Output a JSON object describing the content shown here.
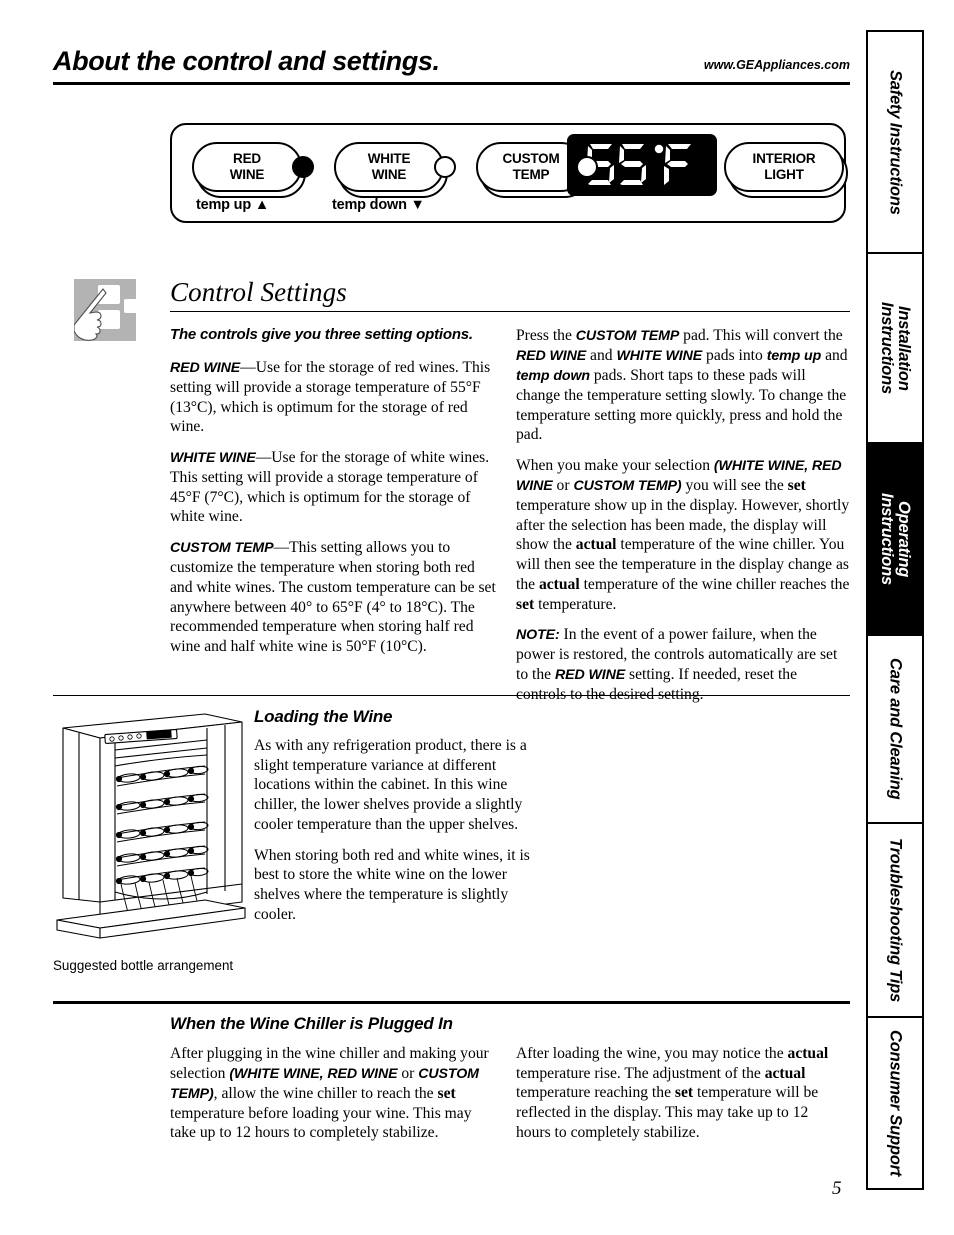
{
  "header": {
    "title": "About the control and settings.",
    "url": "www.GEAppliances.com"
  },
  "control_panel": {
    "pads": [
      {
        "label": "RED\nWINE",
        "sub": "temp up ▲",
        "indicator": "filled"
      },
      {
        "label": "WHITE\nWINE",
        "sub": "temp down ▼",
        "indicator": "hollow"
      },
      {
        "label": "CUSTOM\nTEMP",
        "sub": "",
        "indicator": "hollow"
      },
      {
        "label": "INTERIOR\nLIGHT",
        "sub": "",
        "indicator": "none"
      }
    ],
    "display_value": "55°F"
  },
  "control_settings": {
    "heading": "Control Settings",
    "intro": "The controls give you three setting options.",
    "red_wine_label": "RED WINE",
    "red_wine_text": "—Use for the storage of red wines. This setting will provide a storage temperature of 55°F (13°C), which is optimum for the storage of red wine.",
    "white_wine_label": "WHITE WINE",
    "white_wine_text": "—Use for the storage of white wines. This setting will provide a storage temperature of 45°F (7°C), which is optimum for the storage of white wine.",
    "custom_temp_label": "CUSTOM TEMP",
    "custom_temp_text": "—This setting allows you to customize the temperature when storing both red and white wines. The custom temperature can be set anywhere between 40° to 65°F (4° to 18°C). The recommended temperature when storing half red wine and half white wine is 50°F (10°C).",
    "p_press_1": "Press the ",
    "p_press_custom": "CUSTOM TEMP",
    "p_press_2": " pad. This will convert the ",
    "p_press_red": "RED WINE",
    "p_press_3": " and ",
    "p_press_white": "WHITE WINE",
    "p_press_4": " pads into ",
    "p_press_tempup": "temp up",
    "p_press_5": " and ",
    "p_press_tempdown": "temp down",
    "p_press_6": " pads. Short taps to these pads will change the temperature setting slowly. To change the temperature setting more quickly, press and hold the pad.",
    "p_sel_1": "When you make your selection ",
    "p_sel_paren": "(WHITE WINE, RED WINE",
    "p_sel_or": " or ",
    "p_sel_paren2": "CUSTOM TEMP)",
    "p_sel_2": " you will see the ",
    "p_sel_set": "set",
    "p_sel_3": " temperature show up in the display. However, shortly after the selection has been made, the display will show the ",
    "p_sel_actual": "actual",
    "p_sel_4": " temperature of the wine chiller. You will then see the temperature in the display change as the ",
    "p_sel_actual2": "actual",
    "p_sel_5": " temperature of the wine chiller reaches the ",
    "p_sel_set2": "set",
    "p_sel_6": " temperature.",
    "note_label": "NOTE:",
    "note_1": " In the event of a power failure, when the power is restored, the controls automatically are set to the ",
    "note_red": "RED WINE",
    "note_2": " setting. If needed, reset the controls to the desired setting."
  },
  "loading_the_wine": {
    "heading": "Loading the Wine",
    "p1": "As with any refrigeration product, there is a slight temperature variance at different locations within the cabinet. In this wine chiller, the lower shelves provide a slightly cooler temperature than the upper shelves.",
    "p2": "When storing both red and white wines, it is best to store the white wine on the lower shelves where the temperature is slightly cooler.",
    "art_caption": "Suggested bottle arrangement"
  },
  "plugged_in": {
    "heading": "When the Wine Chiller is Plugged In",
    "left_1": "After plugging in the wine chiller and making your selection ",
    "left_paren": "(WHITE WINE, RED WINE",
    "left_or": " or ",
    "left_paren2": "CUSTOM TEMP)",
    "left_2": ", allow the wine chiller to reach the ",
    "left_set": "set",
    "left_3": " temperature before loading your wine. This may take up to 12 hours to completely stabilize.",
    "right_1": "After loading the wine, you may notice the ",
    "right_actual": "actual",
    "right_2": " temperature rise. The adjustment of the ",
    "right_actual2": "actual",
    "right_3": " temperature reaching the ",
    "right_set": "set",
    "right_4": " temperature will be reflected in the display. This may take up to 12 hours to completely stabilize."
  },
  "tabs": [
    {
      "label": "Safety Instructions",
      "active": false
    },
    {
      "label": "Installation\nInstructions",
      "active": false
    },
    {
      "label": "Operating\nInstructions",
      "active": true
    },
    {
      "label": "Care and Cleaning",
      "active": false
    },
    {
      "label": "Troubleshooting Tips",
      "active": false
    },
    {
      "label": "Consumer Support",
      "active": false
    }
  ],
  "page_number": "5"
}
